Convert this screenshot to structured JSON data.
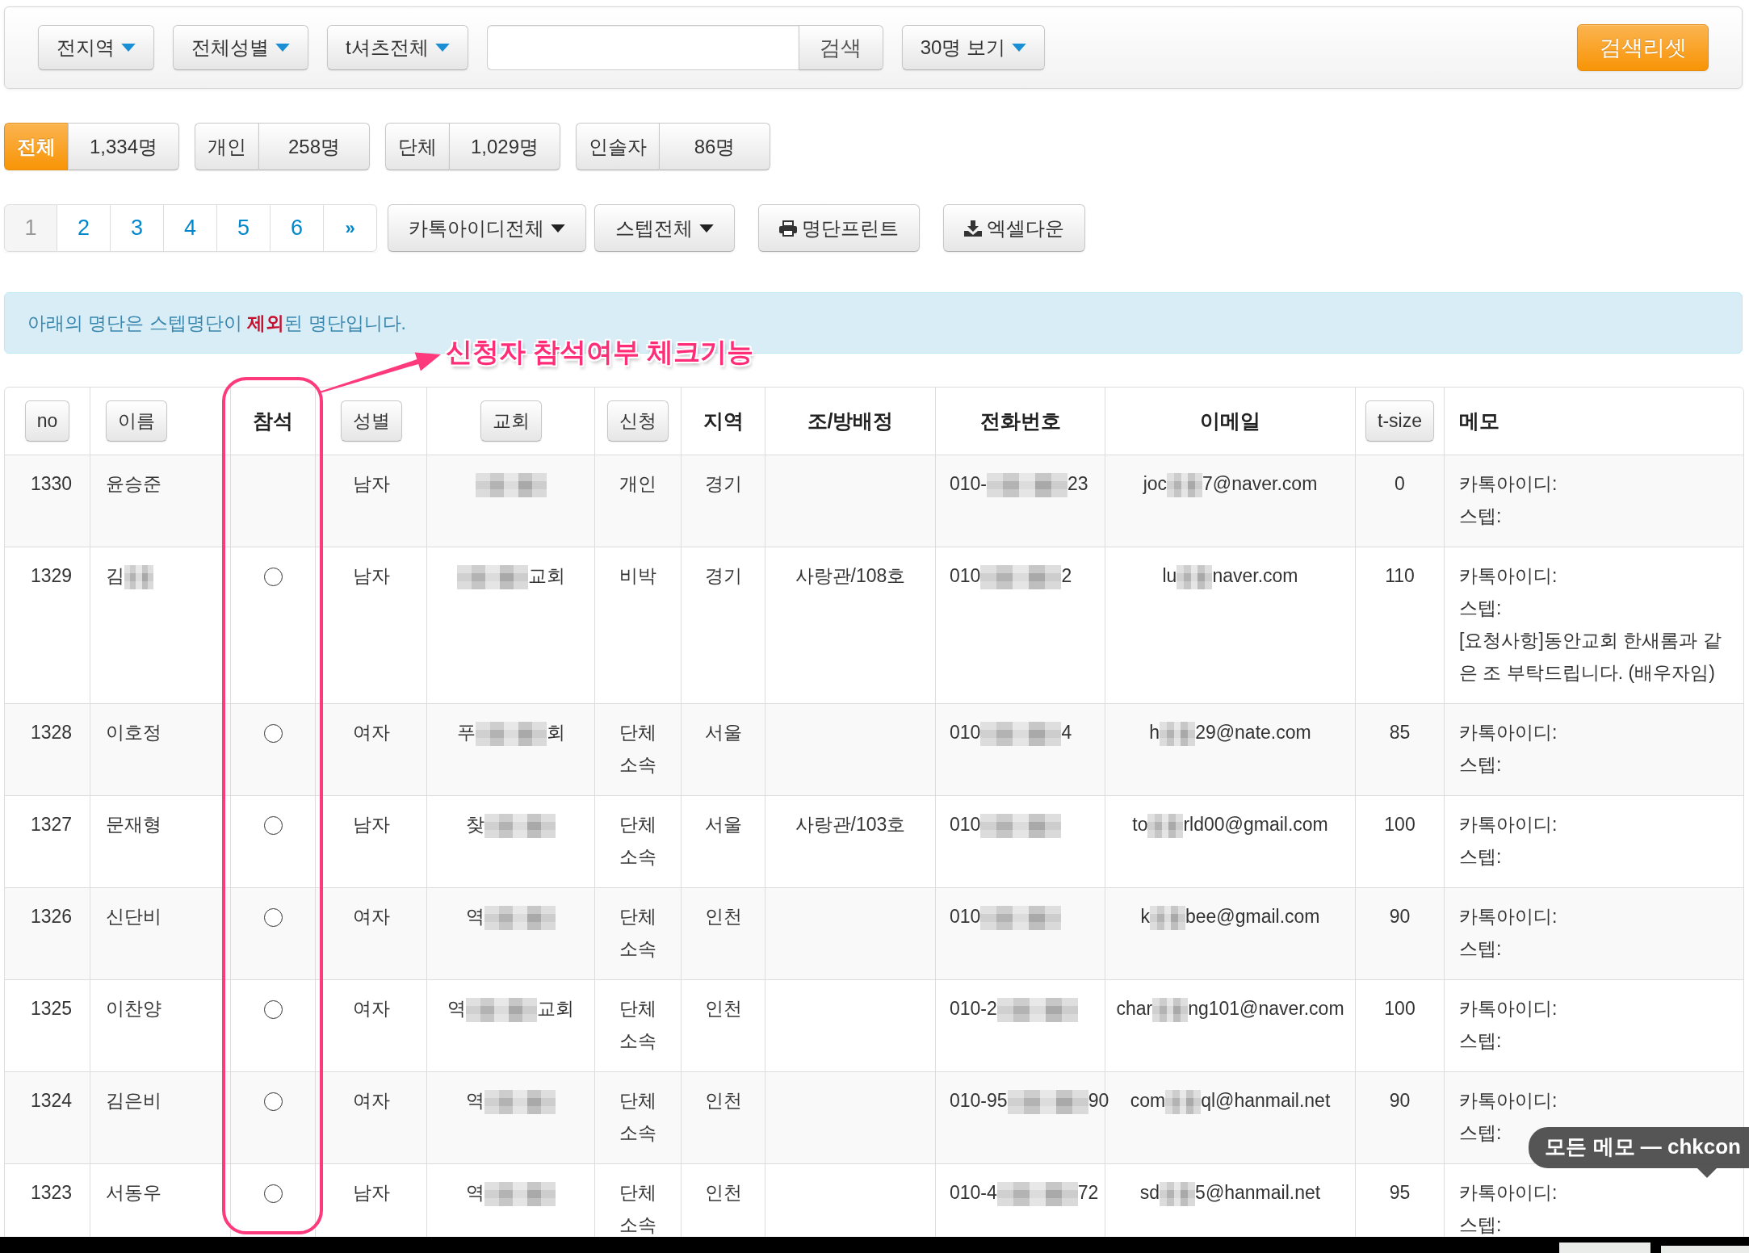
{
  "toolbar": {
    "filters": [
      "전지역",
      "전체성별",
      "t셔츠전체"
    ],
    "search_button": "검색",
    "page_size": "30명 보기",
    "reset_button": "검색리셋"
  },
  "categories": [
    {
      "label": "전체",
      "count": "1,334명",
      "selected": true
    },
    {
      "label": "개인",
      "count": "258명",
      "selected": false
    },
    {
      "label": "단체",
      "count": "1,029명",
      "selected": false
    },
    {
      "label": "인솔자",
      "count": "86명",
      "selected": false
    }
  ],
  "pagination": {
    "pages": [
      {
        "label": "1",
        "selected": true
      },
      {
        "label": "2",
        "selected": false
      },
      {
        "label": "3",
        "selected": false
      },
      {
        "label": "4",
        "selected": false
      },
      {
        "label": "5",
        "selected": false
      },
      {
        "label": "6",
        "selected": false
      }
    ],
    "next": "»"
  },
  "actions": {
    "dropdowns": [
      "카톡아이디전체",
      "스텝전체"
    ],
    "print_button": "명단프린트",
    "excel_button": "엑셀다운"
  },
  "notice": "아래의 명단은 스텝명단이 **제외**된 명단입니다.",
  "annotation": "신청자 참석여부 체크기능",
  "table": {
    "columns": [
      {
        "label": "no",
        "kind": "sort"
      },
      {
        "label": "이름",
        "kind": "sort"
      },
      {
        "label": "참석",
        "kind": "plain"
      },
      {
        "label": "성별",
        "kind": "sort"
      },
      {
        "label": "교회",
        "kind": "sort"
      },
      {
        "label": "신청",
        "kind": "sort"
      },
      {
        "label": "지역",
        "kind": "plain"
      },
      {
        "label": "조/방배정",
        "kind": "plain"
      },
      {
        "label": "전화번호",
        "kind": "plain"
      },
      {
        "label": "이메일",
        "kind": "plain"
      },
      {
        "label": "t-size",
        "kind": "sort"
      },
      {
        "label": "메모",
        "kind": "plain"
      }
    ],
    "rows": [
      {
        "no": "1330",
        "name": "윤승준",
        "gender": "남자",
        "church": [
          {
            "kind": "redacted"
          }
        ],
        "signup": "개인",
        "region": "경기",
        "phone": [
          {
            "kind": "text",
            "text": "010-"
          },
          {
            "kind": "redacted"
          },
          {
            "kind": "text",
            "text": "23"
          }
        ],
        "email": [
          {
            "kind": "text",
            "text": "joc"
          },
          {
            "kind": "redacted"
          },
          {
            "kind": "text",
            "text": "7@naver.com"
          }
        ],
        "tsize": "0",
        "memo": [
          "카톡아이디:",
          "스텝:"
        ]
      },
      {
        "no": "1329",
        "name": [
          {
            "kind": "text",
            "text": "김"
          },
          {
            "kind": "redacted"
          }
        ],
        "attendance": {
          "checked": false
        },
        "gender": "남자",
        "church": [
          {
            "kind": "redacted"
          },
          {
            "kind": "text",
            "text": "교회"
          }
        ],
        "signup": "비박",
        "region": "경기",
        "room": "사랑관/108호",
        "phone": [
          {
            "kind": "text",
            "text": "010"
          },
          {
            "kind": "redacted"
          },
          {
            "kind": "text",
            "text": "2"
          }
        ],
        "email": [
          {
            "kind": "text",
            "text": "lu"
          },
          {
            "kind": "redacted"
          },
          {
            "kind": "text",
            "text": "naver.com"
          }
        ],
        "tsize": "110",
        "memo": [
          "카톡아이디:",
          "스텝:",
          "[요청사항]동안교회 한새롬과 같은 조 부탁드립니다. (배우자임)"
        ]
      },
      {
        "no": "1328",
        "name": "이호정",
        "attendance": {
          "checked": false
        },
        "gender": "여자",
        "church": [
          {
            "kind": "text",
            "text": "푸"
          },
          {
            "kind": "redacted"
          },
          {
            "kind": "text",
            "text": "회"
          }
        ],
        "signup": "단체 소속",
        "region": "서울",
        "phone": [
          {
            "kind": "text",
            "text": "010"
          },
          {
            "kind": "redacted"
          },
          {
            "kind": "text",
            "text": "4"
          }
        ],
        "email": [
          {
            "kind": "text",
            "text": "h"
          },
          {
            "kind": "redacted"
          },
          {
            "kind": "text",
            "text": "29@nate.com"
          }
        ],
        "tsize": "85",
        "memo": [
          "카톡아이디:",
          "스텝:"
        ]
      },
      {
        "no": "1327",
        "name": "문재형",
        "attendance": {
          "checked": false
        },
        "gender": "남자",
        "church": [
          {
            "kind": "text",
            "text": "찾"
          },
          {
            "kind": "redacted"
          }
        ],
        "signup": "단체 소속",
        "region": "서울",
        "room": "사랑관/103호",
        "phone": [
          {
            "kind": "text",
            "text": "010"
          },
          {
            "kind": "redacted"
          }
        ],
        "email": [
          {
            "kind": "text",
            "text": "to"
          },
          {
            "kind": "redacted"
          },
          {
            "kind": "text",
            "text": "rld00@gmail.com"
          }
        ],
        "tsize": "100",
        "memo": [
          "카톡아이디:",
          "스텝:"
        ]
      },
      {
        "no": "1326",
        "name": "신단비",
        "attendance": {
          "checked": false
        },
        "gender": "여자",
        "church": [
          {
            "kind": "text",
            "text": "역"
          },
          {
            "kind": "redacted"
          }
        ],
        "signup": "단체 소속",
        "region": "인천",
        "phone": [
          {
            "kind": "text",
            "text": "010"
          },
          {
            "kind": "redacted"
          }
        ],
        "email": [
          {
            "kind": "text",
            "text": "k"
          },
          {
            "kind": "redacted"
          },
          {
            "kind": "text",
            "text": "bee@gmail.com"
          }
        ],
        "tsize": "90",
        "memo": [
          "카톡아이디:",
          "스텝:"
        ]
      },
      {
        "no": "1325",
        "name": "이찬양",
        "attendance": {
          "checked": false
        },
        "gender": "여자",
        "church": [
          {
            "kind": "text",
            "text": "역"
          },
          {
            "kind": "redacted"
          },
          {
            "kind": "text",
            "text": "교회"
          }
        ],
        "signup": "단체 소속",
        "region": "인천",
        "phone": [
          {
            "kind": "text",
            "text": "010-2"
          },
          {
            "kind": "redacted"
          }
        ],
        "email": [
          {
            "kind": "text",
            "text": "char"
          },
          {
            "kind": "redacted"
          },
          {
            "kind": "text",
            "text": "ng101@naver.com"
          }
        ],
        "tsize": "100",
        "memo": [
          "카톡아이디:",
          "스텝:"
        ]
      },
      {
        "no": "1324",
        "name": "김은비",
        "attendance": {
          "checked": false
        },
        "gender": "여자",
        "church": [
          {
            "kind": "text",
            "text": "역"
          },
          {
            "kind": "redacted"
          }
        ],
        "signup": "단체 소속",
        "region": "인천",
        "phone": [
          {
            "kind": "text",
            "text": "010-95"
          },
          {
            "kind": "redacted"
          },
          {
            "kind": "text",
            "text": "90"
          }
        ],
        "email": [
          {
            "kind": "text",
            "text": "com"
          },
          {
            "kind": "redacted"
          },
          {
            "kind": "text",
            "text": "ql@hanmail.net"
          }
        ],
        "tsize": "90",
        "memo": [
          "카톡아이디:",
          "스텝:"
        ]
      },
      {
        "no": "1323",
        "name": "서동우",
        "attendance": {
          "checked": false
        },
        "gender": "남자",
        "church": [
          {
            "kind": "text",
            "text": "역"
          },
          {
            "kind": "redacted"
          }
        ],
        "signup": "단체 소속",
        "region": "인천",
        "phone": [
          {
            "kind": "text",
            "text": "010-4"
          },
          {
            "kind": "redacted"
          },
          {
            "kind": "text",
            "text": "72"
          }
        ],
        "email": [
          {
            "kind": "text",
            "text": "sd"
          },
          {
            "kind": "redacted"
          },
          {
            "kind": "text",
            "text": "5@hanmail.net"
          }
        ],
        "tsize": "95",
        "memo": [
          "카톡아이디:",
          "스텝:"
        ]
      }
    ]
  },
  "tooltip": "모든 메모 — chkcon"
}
